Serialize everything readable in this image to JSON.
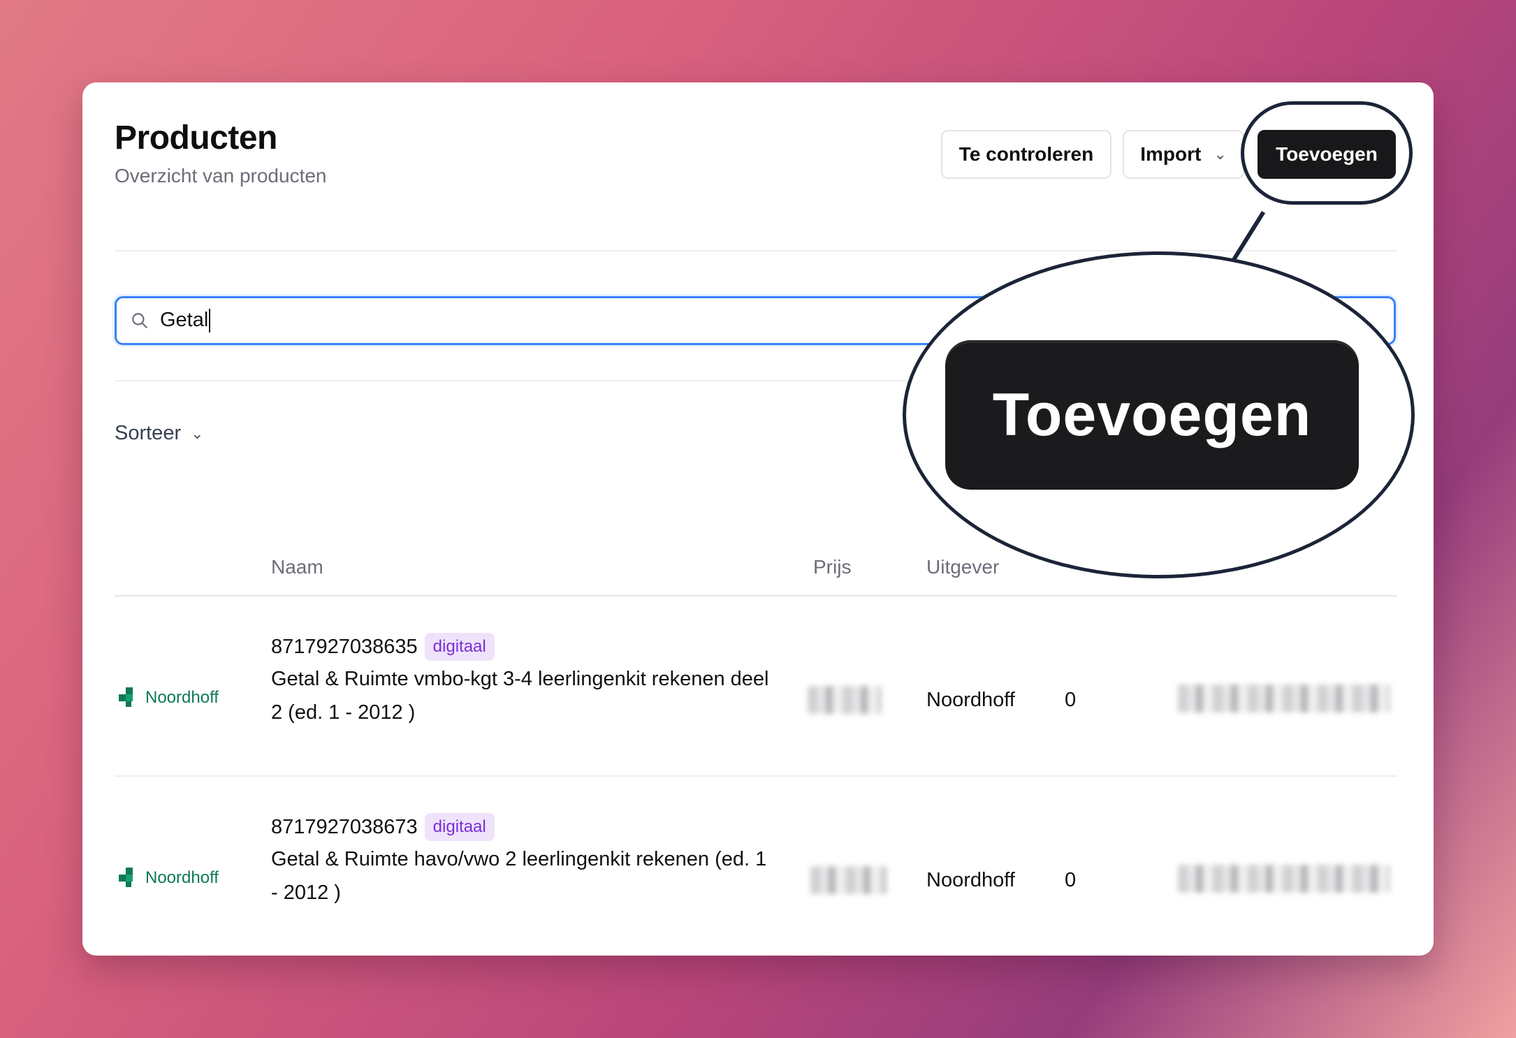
{
  "page": {
    "title": "Producten",
    "subtitle": "Overzicht van producten"
  },
  "toolbar": {
    "review_label": "Te controleren",
    "import_label": "Import",
    "add_label": "Toevoegen"
  },
  "search": {
    "value": "Getal",
    "icon": "search-icon"
  },
  "sort": {
    "label": "Sorteer"
  },
  "table": {
    "columns": [
      "Naam",
      "Prijs",
      "Uitgever"
    ],
    "rows": [
      {
        "logo": "Noordhoff",
        "ean": "8717927038635",
        "badge": "digitaal",
        "name": "Getal & Ruimte vmbo-kgt 3-4 leerlingenkit rekenen deel 2 (ed. 1 - 2012 )",
        "publisher": "Noordhoff",
        "count": "0"
      },
      {
        "logo": "Noordhoff",
        "ean": "8717927038673",
        "badge": "digitaal",
        "name": "Getal & Ruimte havo/vwo 2 leerlingenkit rekenen (ed. 1 - 2012 )",
        "publisher": "Noordhoff",
        "count": "0"
      }
    ]
  },
  "magnifier": {
    "label": "Toevoegen"
  },
  "colors": {
    "accent": "#3b82f6",
    "primary_button": "#18181b",
    "badge_bg": "#efe3fb",
    "badge_text": "#7a2fd6",
    "brand_green": "#0e7a55"
  }
}
